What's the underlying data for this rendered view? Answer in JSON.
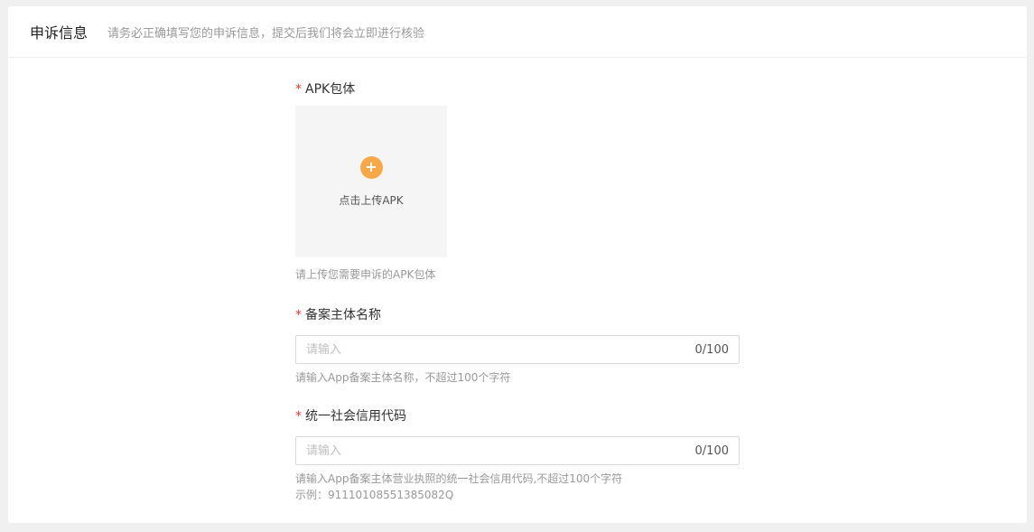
{
  "header": {
    "title": "申诉信息",
    "subtitle": "请务必正确填写您的申诉信息，提交后我们将会立即进行核验"
  },
  "form": {
    "required_mark": "*",
    "apk": {
      "label": "APK包体",
      "upload_text": "点击上传APK",
      "upload_icon": "plus-icon",
      "hint": "请上传您需要申诉的APK包体"
    },
    "entity_name": {
      "label": "备案主体名称",
      "value": "",
      "placeholder": "请输入",
      "counter": "0/100",
      "hint": "请输入App备案主体名称，不超过100个字符"
    },
    "credit_code": {
      "label": "统一社会信用代码",
      "value": "",
      "placeholder": "请输入",
      "counter": "0/100",
      "hint": "请输入App备案主体营业执照的统一社会信用代码,不超过100个字符",
      "example": "示例：91110108551385082Q"
    }
  },
  "colors": {
    "required": "#e4393c",
    "upload_icon": "#f7a94a",
    "upload_bg": "#f5f5f5"
  }
}
